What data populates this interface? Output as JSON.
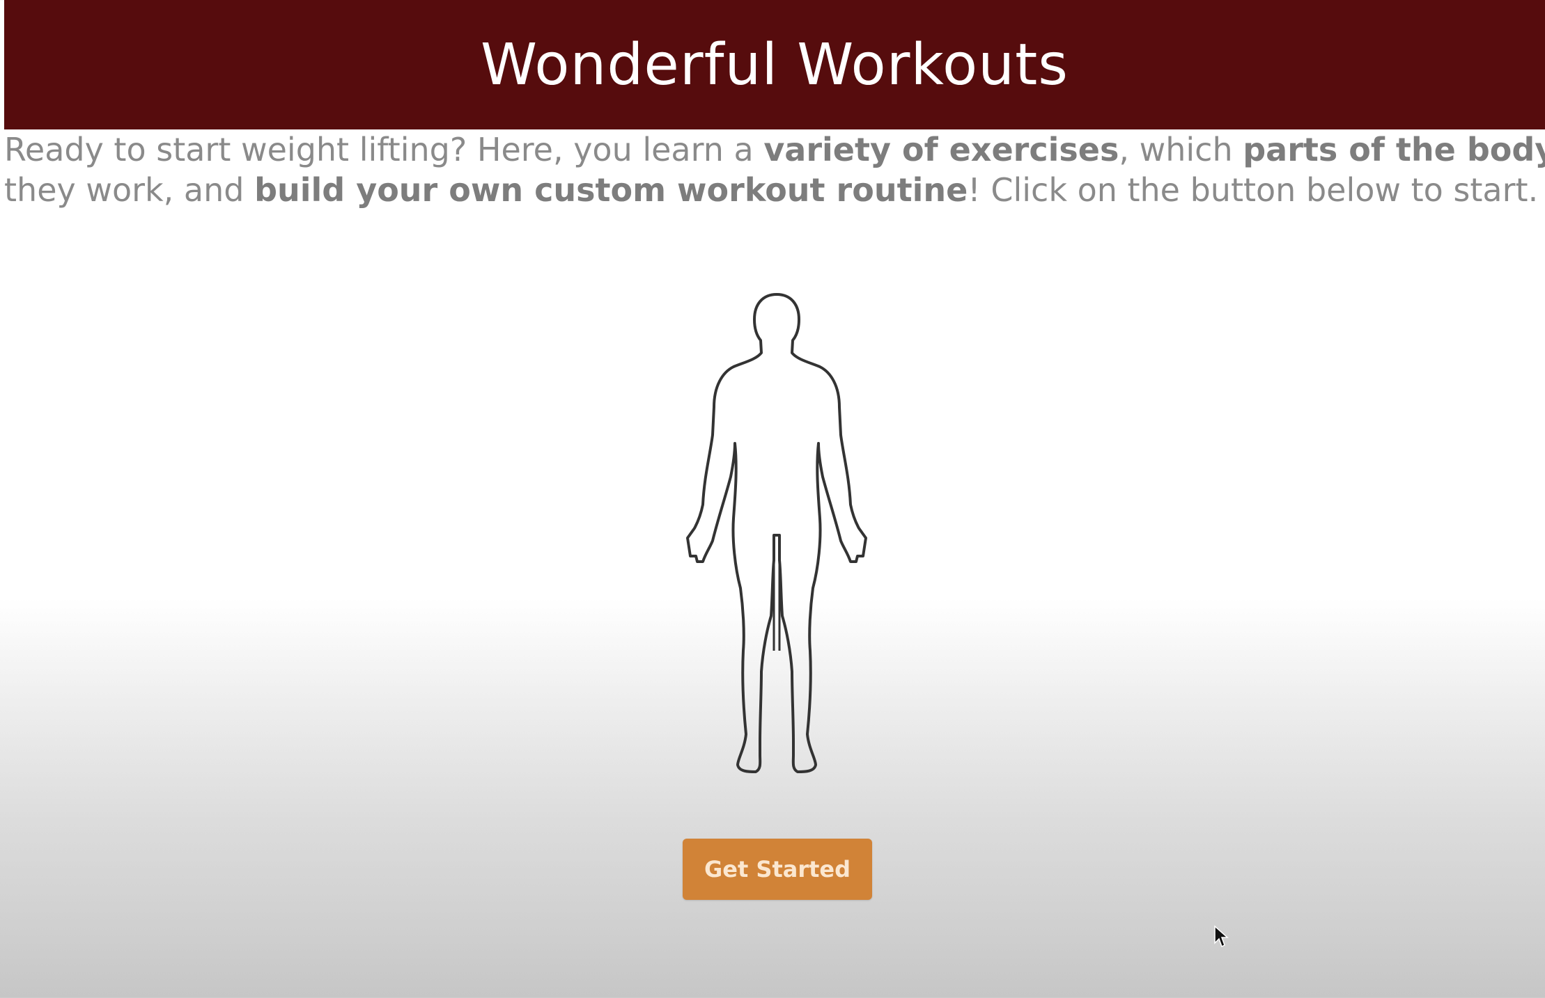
{
  "header": {
    "title": "Wonderful Workouts"
  },
  "intro": {
    "line1_a": "Ready to start weight lifting? Here, you learn a ",
    "line1_b": "variety of exercises",
    "line1_c": ", which ",
    "line1_d": "parts of the body",
    "line2_a": "they work, and ",
    "line2_b": "build your own custom workout routine",
    "line2_c": "! Click on the button below to start."
  },
  "body_figure": {
    "icon": "human-body-outline-icon"
  },
  "cta": {
    "label": "Get Started"
  },
  "colors": {
    "header_bg": "#560c0d",
    "button_bg": "#d18337",
    "text": "#8a8a8a"
  }
}
